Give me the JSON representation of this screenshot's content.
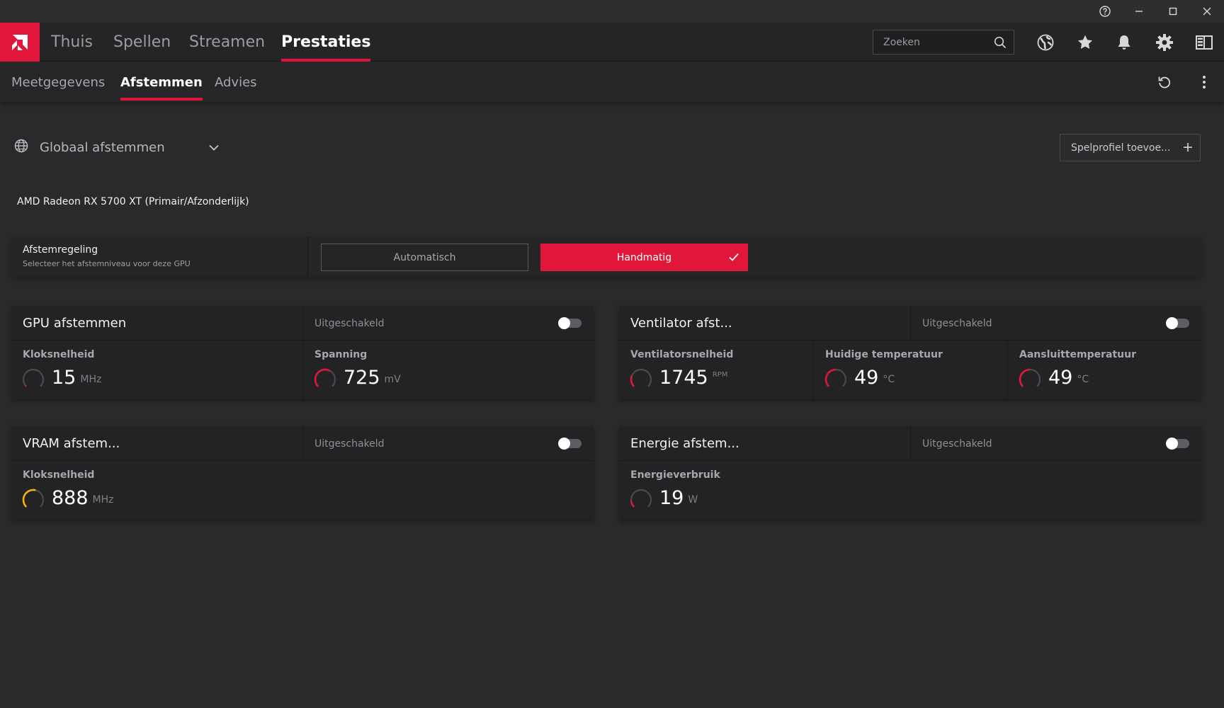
{
  "colors": {
    "accent": "#e0173a",
    "gauge_red": "#e0173a",
    "gauge_yellow": "#f5b400"
  },
  "window": {
    "icons": [
      "help-icon",
      "minimize-icon",
      "maximize-icon",
      "close-icon"
    ]
  },
  "main_nav": {
    "tabs": [
      {
        "label": "Thuis"
      },
      {
        "label": "Spellen"
      },
      {
        "label": "Streamen"
      },
      {
        "label": "Prestaties",
        "active": true
      }
    ],
    "search_placeholder": "Zoeken",
    "icons": [
      "globe-icon",
      "star-icon",
      "bell-icon",
      "gear-icon",
      "sidebar-icon"
    ]
  },
  "sub_nav": {
    "tabs": [
      {
        "label": "Meetgegevens"
      },
      {
        "label": "Afstemmen",
        "active": true
      },
      {
        "label": "Advies"
      }
    ],
    "icons": [
      "reset-icon",
      "more-vertical-icon"
    ]
  },
  "profile": {
    "label": "Globaal afstemmen",
    "add_button": "Spelprofiel toevoe..."
  },
  "gpu_name": "AMD Radeon RX 5700 XT (Primair/Afzonderlijk)",
  "tuning_control": {
    "title": "Afstemregeling",
    "subtitle": "Selecteer het afstemniveau voor deze GPU",
    "option_auto": "Automatisch",
    "option_manual": "Handmatig",
    "selected": "Handmatig"
  },
  "cards": {
    "gpu": {
      "title": "GPU afstemmen",
      "status": "Uitgeschakeld",
      "metrics": [
        {
          "label": "Kloksnelheid",
          "value": "15",
          "unit": "MHz",
          "fill": 0.02
        },
        {
          "label": "Spanning",
          "value": "725",
          "unit": "mV",
          "fill": 0.6
        }
      ]
    },
    "fan": {
      "title": "Ventilator afst...",
      "status": "Uitgeschakeld",
      "metrics": [
        {
          "label": "Ventilatorsnelheid",
          "value": "1745",
          "unit": "RPM",
          "fill": 0.25
        },
        {
          "label": "Huidige temperatuur",
          "value": "49",
          "unit": "°C",
          "fill": 0.5
        },
        {
          "label": "Aansluittemperatuur",
          "value": "49",
          "unit": "°C",
          "fill": 0.5
        }
      ]
    },
    "vram": {
      "title": "VRAM afstem...",
      "status": "Uitgeschakeld",
      "metrics": [
        {
          "label": "Kloksnelheid",
          "value": "888",
          "unit": "MHz",
          "fill": 0.55
        }
      ]
    },
    "power": {
      "title": "Energie afstem...",
      "status": "Uitgeschakeld",
      "metrics": [
        {
          "label": "Energieverbruik",
          "value": "19",
          "unit": "W",
          "fill": 0.15
        }
      ]
    }
  }
}
